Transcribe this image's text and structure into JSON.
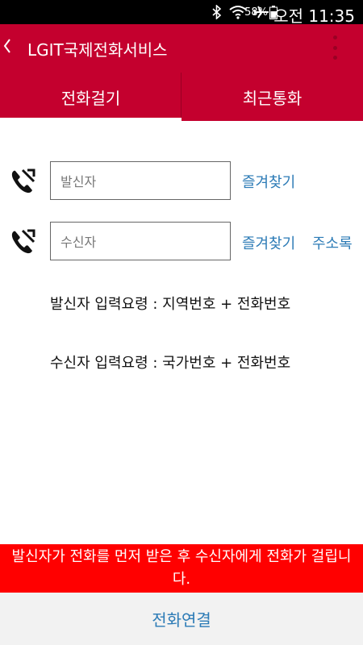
{
  "status_bar": {
    "icons": [
      "bluetooth-icon",
      "wifi-icon",
      "airplane-icon"
    ],
    "battery": "58%",
    "time": "오전 11:35"
  },
  "app_bar": {
    "back_icon": "back-chevron-icon",
    "title": "LGIT국제전화서비스",
    "menu_icon": "overflow-menu-icon"
  },
  "tabs": [
    {
      "label": "전화걸기",
      "selected": true
    },
    {
      "label": "최근통화",
      "selected": false
    }
  ],
  "caller": {
    "icon": "phone-forward-icon",
    "placeholder": "발신자",
    "favorites_label": "즐겨찾기"
  },
  "receiver": {
    "icon": "phone-forward-icon",
    "placeholder": "수신자",
    "favorites_label": "즐겨찾기",
    "contacts_label": "주소록"
  },
  "guides": {
    "caller_guide": "발신자 입력요령 : 지역번호 + 전화번호",
    "receiver_guide": "수신자 입력요령 : 국가번호 + 전화번호"
  },
  "notice": "발신자가 전화를 먼저 받은 후 수신자에게 전화가 걸립니다.",
  "bottom": {
    "connect_label": "전화연결"
  },
  "colors": {
    "brand": "#c4002e",
    "link": "#2c7bb6",
    "notice_bg": "#ff0000"
  }
}
